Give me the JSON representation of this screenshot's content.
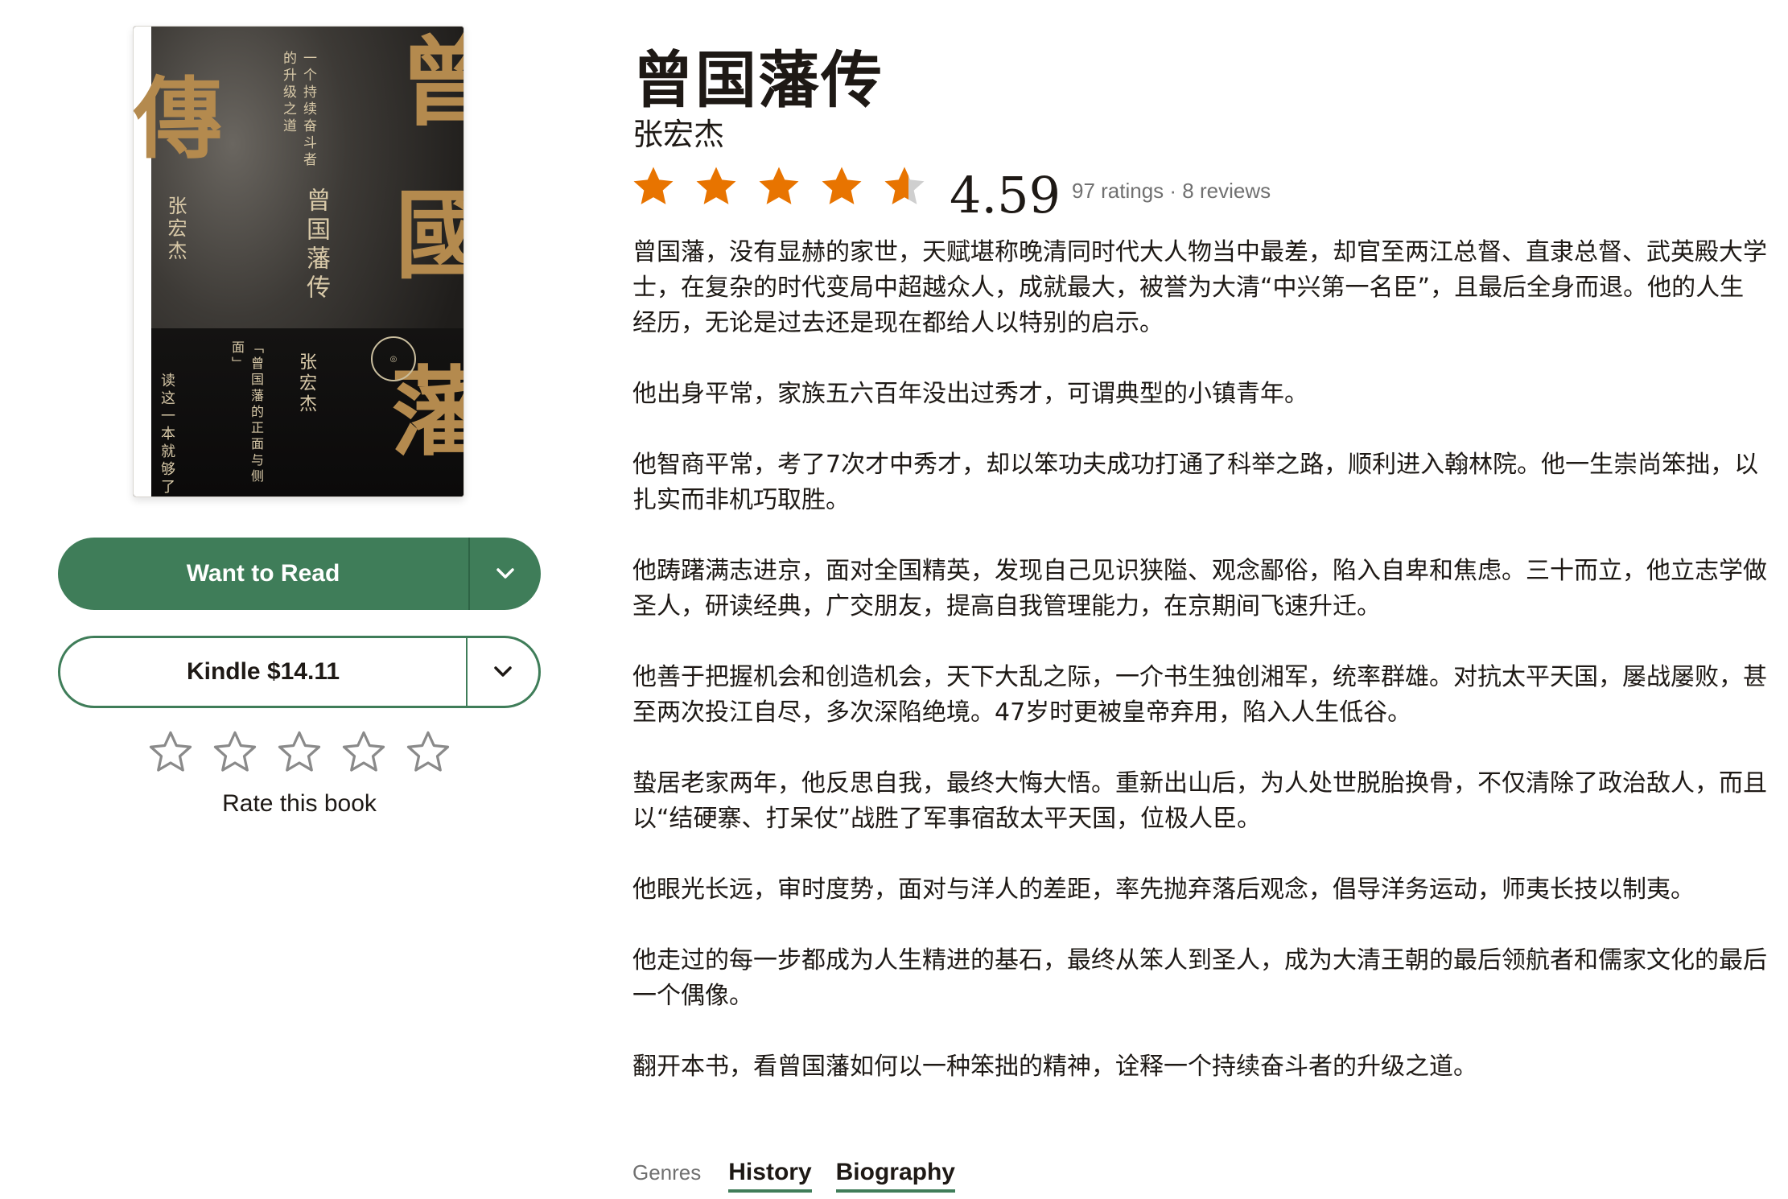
{
  "book": {
    "title": "曾国藩传",
    "author": "张宏杰",
    "rating": "4.59",
    "rating_fraction": 0.59,
    "ratings_count_text": "97 ratings · 8 reviews",
    "star_color": "#e87400"
  },
  "cover": {
    "title_big_1": "曾",
    "title_big_2": "國",
    "title_big_3": "藩",
    "title_big_4": "傳",
    "subtitle": "一个持续奋斗者的升级之道",
    "title_small": "曾国藩传",
    "author": "张宏杰",
    "blurb_1": "「曾国藩的正面与侧面」",
    "blurb_2": "读这一本就够了"
  },
  "actions": {
    "want_to_read": "Want to Read",
    "kindle": "Kindle $14.11",
    "rate_label": "Rate this book",
    "brand_color": "#3f7d59"
  },
  "description": [
    "曾国藩，没有显赫的家世，天赋堪称晚清同时代大人物当中最差，却官至两江总督、直隶总督、武英殿大学士，在复杂的时代变局中超越众人，成就最大，被誉为大清“中兴第一名臣”，且最后全身而退。他的人生经历，无论是过去还是现在都给人以特别的启示。",
    "他出身平常，家族五六百年没出过秀才，可谓典型的小镇青年。",
    "他智商平常，考了7次才中秀才，却以笨功夫成功打通了科举之路，顺利进入翰林院。他一生崇尚笨拙，以扎实而非机巧取胜。",
    "他踌躇满志进京，面对全国精英，发现自己见识狭隘、观念鄙俗，陷入自卑和焦虑。三十而立，他立志学做圣人，研读经典，广交朋友，提高自我管理能力，在京期间飞速升迁。",
    "他善于把握机会和创造机会，天下大乱之际，一介书生独创湘军，统率群雄。对抗太平天国，屡战屡败，甚至两次投江自尽，多次深陷绝境。47岁时更被皇帝弃用，陷入人生低谷。",
    "蛰居老家两年，他反思自我，最终大悔大悟。重新出山后，为人处世脱胎换骨，不仅清除了政治敌人，而且以“结硬寨、打呆仗”战胜了军事宿敌太平天国，位极人臣。",
    "他眼光长远，审时度势，面对与洋人的差距，率先抛弃落后观念，倡导洋务运动，师夷长技以制夷。",
    "他走过的每一步都成为人生精进的基石，最终从笨人到圣人，成为大清王朝的最后领航者和儒家文化的最后一个偶像。",
    "翻开本书，看曾国藩如何以一种笨拙的精神，诠释一个持续奋斗者的升级之道。"
  ],
  "genres": {
    "label": "Genres",
    "items": [
      "History",
      "Biography"
    ]
  }
}
